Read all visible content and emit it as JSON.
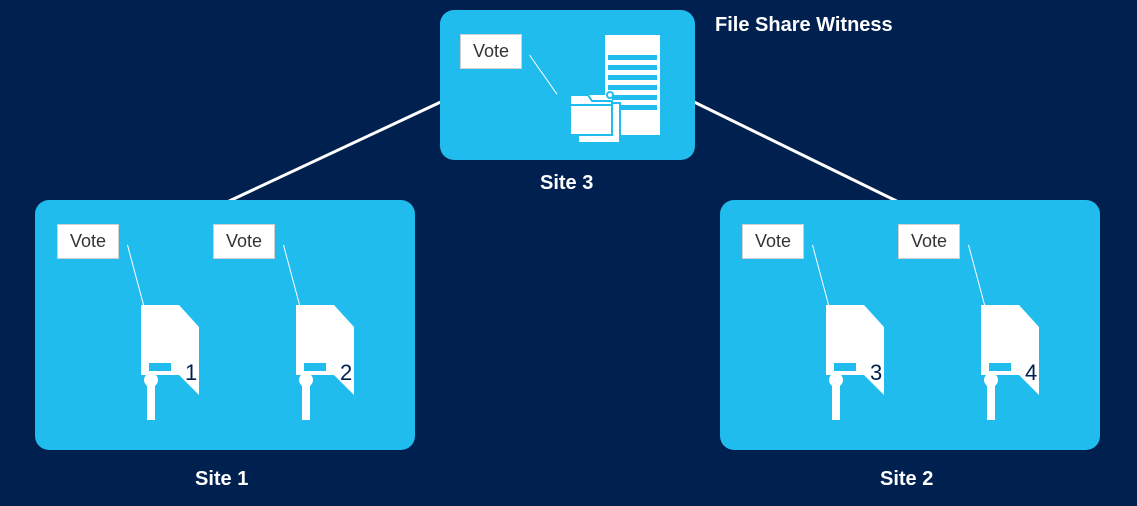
{
  "title_label": "File Share Witness",
  "sites": {
    "site3": {
      "label": "Site 3",
      "vote_label": "Vote"
    },
    "site1": {
      "label": "Site 1",
      "nodes": [
        {
          "vote": "Vote",
          "num": "1"
        },
        {
          "vote": "Vote",
          "num": "2"
        }
      ]
    },
    "site2": {
      "label": "Site 2",
      "nodes": [
        {
          "vote": "Vote",
          "num": "3"
        },
        {
          "vote": "Vote",
          "num": "4"
        }
      ]
    }
  }
}
